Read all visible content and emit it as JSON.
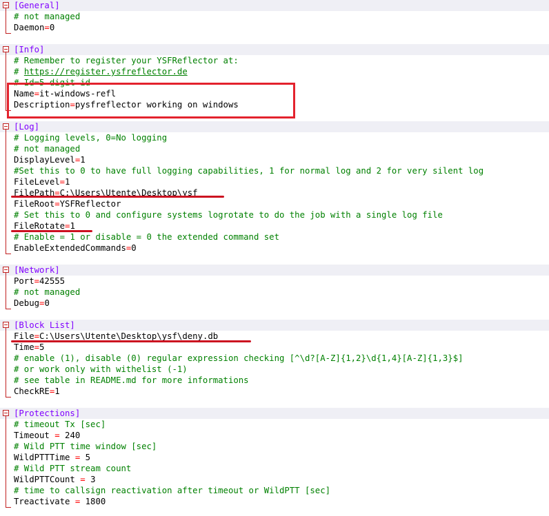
{
  "accent_colors": {
    "section": "#8000ff",
    "comment": "#008000",
    "operator": "#ff0000",
    "annotation": "#e3222d",
    "fold_marker": "#c02020"
  },
  "sections": [
    {
      "header": "[General]",
      "lines": [
        {
          "type": "comment",
          "text": "# not managed"
        },
        {
          "type": "kv",
          "key": "Daemon",
          "sep": "=",
          "value": "0"
        }
      ]
    },
    {
      "header": "[Info]",
      "lines": [
        {
          "type": "comment",
          "text": "# Remember to register your YSFReflector at:"
        },
        {
          "type": "comment",
          "prefix": "# ",
          "link": "https://register.ysfreflector.de"
        },
        {
          "type": "comment",
          "text": "# Id=5 digit id"
        },
        {
          "type": "kv",
          "key": "Name",
          "sep": "=",
          "value": "it-windows-refl"
        },
        {
          "type": "kv",
          "key": "Description",
          "sep": "=",
          "value": "pysfreflector working on windows"
        }
      ]
    },
    {
      "header": "[Log]",
      "lines": [
        {
          "type": "comment",
          "text": "# Logging levels, 0=No logging"
        },
        {
          "type": "comment",
          "text": "# not managed"
        },
        {
          "type": "kv",
          "key": "DisplayLevel",
          "sep": "=",
          "value": "1"
        },
        {
          "type": "comment",
          "text": "#Set this to 0 to have full logging capabilities, 1 for normal log and 2 for very silent log"
        },
        {
          "type": "kv",
          "key": "FileLevel",
          "sep": "=",
          "value": "1"
        },
        {
          "type": "kv",
          "key": "FilePath",
          "sep": "=",
          "value": "C:\\Users\\Utente\\Desktop\\ysf"
        },
        {
          "type": "kv",
          "key": "FileRoot",
          "sep": "=",
          "value": "YSFReflector"
        },
        {
          "type": "comment",
          "text": "# Set this to 0 and configure systems logrotate to do the job with a single log file"
        },
        {
          "type": "kv",
          "key": "FileRotate",
          "sep": "=",
          "value": "1"
        },
        {
          "type": "comment",
          "text": "# Enable = 1 or disable = 0 the extended command set"
        },
        {
          "type": "kv",
          "key": "EnableExtendedCommands",
          "sep": "=",
          "value": "0"
        }
      ]
    },
    {
      "header": "[Network]",
      "lines": [
        {
          "type": "kv",
          "key": "Port",
          "sep": "=",
          "value": "42555"
        },
        {
          "type": "comment",
          "text": "# not managed"
        },
        {
          "type": "kv",
          "key": "Debug",
          "sep": "=",
          "value": "0"
        }
      ]
    },
    {
      "header": "[Block List]",
      "lines": [
        {
          "type": "kv",
          "key": "File",
          "sep": "=",
          "value": "C:\\Users\\Utente\\Desktop\\ysf\\deny.db"
        },
        {
          "type": "kv",
          "key": "Time",
          "sep": "=",
          "value": "5"
        },
        {
          "type": "comment",
          "text": "# enable (1), disable (0) regular expression checking [^\\d?[A-Z]{1,2}\\d{1,4}[A-Z]{1,3}$]"
        },
        {
          "type": "comment",
          "text": "# or work only with withelist (-1)"
        },
        {
          "type": "comment",
          "text": "# see table in README.md for more informations"
        },
        {
          "type": "kv",
          "key": "CheckRE",
          "sep": "=",
          "value": "1"
        }
      ]
    },
    {
      "header": "[Protections]",
      "lines": [
        {
          "type": "comment",
          "text": "# timeout Tx [sec]"
        },
        {
          "type": "kv",
          "key": "Timeout",
          "sep": " = ",
          "value": "240"
        },
        {
          "type": "comment",
          "text": "# Wild PTT time window [sec]"
        },
        {
          "type": "kv",
          "key": "WildPTTTime",
          "sep": " = ",
          "value": "5"
        },
        {
          "type": "comment",
          "text": "# Wild PTT stream count"
        },
        {
          "type": "kv",
          "key": "WildPTTCount",
          "sep": " = ",
          "value": "3"
        },
        {
          "type": "comment",
          "text": "# time to callsign reactivation after timeout or WildPTT [sec]"
        },
        {
          "type": "kv",
          "key": "Treactivate",
          "sep": " = ",
          "value": "1800"
        }
      ]
    }
  ]
}
